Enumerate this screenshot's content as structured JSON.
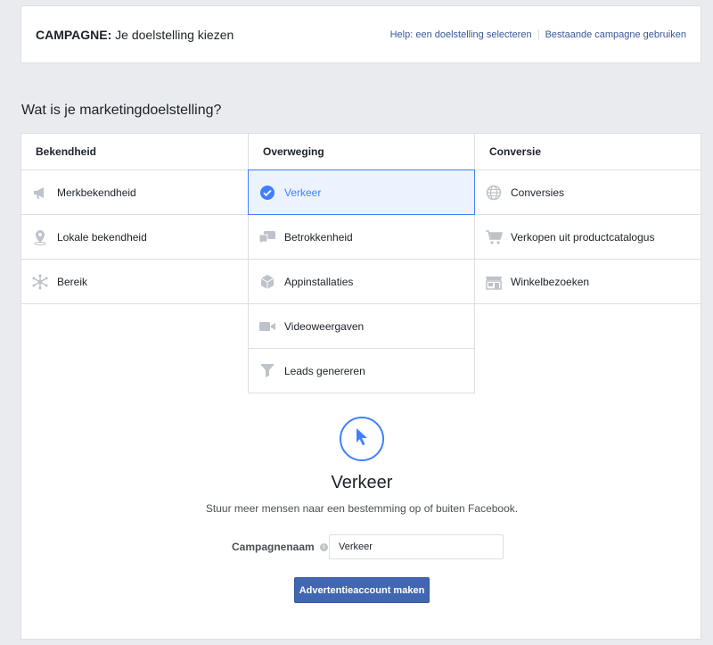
{
  "header": {
    "title_strong": "CAMPAGNE:",
    "title_rest": " Je doelstelling kiezen",
    "help_link": "Help: een doelstelling selecteren",
    "existing_link": "Bestaande campagne gebruiken"
  },
  "question": "Wat is je marketingdoelstelling?",
  "columns": [
    {
      "heading": "Bekendheid",
      "options": [
        {
          "label": "Merkbekendheid",
          "icon": "megaphone-icon"
        },
        {
          "label": "Lokale bekendheid",
          "icon": "map-pin-icon"
        },
        {
          "label": "Bereik",
          "icon": "reach-icon"
        }
      ]
    },
    {
      "heading": "Overweging",
      "options": [
        {
          "label": "Verkeer",
          "icon": "check-circle-icon",
          "selected": true
        },
        {
          "label": "Betrokkenheid",
          "icon": "chat-bubbles-icon"
        },
        {
          "label": "Appinstallaties",
          "icon": "box-icon"
        },
        {
          "label": "Videoweergaven",
          "icon": "video-camera-icon"
        },
        {
          "label": "Leads genereren",
          "icon": "funnel-icon"
        }
      ]
    },
    {
      "heading": "Conversie",
      "options": [
        {
          "label": "Conversies",
          "icon": "globe-icon"
        },
        {
          "label": "Verkopen uit productcatalogus",
          "icon": "shopping-cart-icon"
        },
        {
          "label": "Winkelbezoeken",
          "icon": "store-icon"
        }
      ]
    }
  ],
  "detail": {
    "icon": "cursor-icon",
    "title": "Verkeer",
    "description": "Stuur meer mensen naar een bestemming op of buiten Facebook."
  },
  "campaign_name": {
    "label": "Campagnenaam",
    "value": "Verkeer"
  },
  "create_button": "Advertentieaccount maken",
  "colors": {
    "accent": "#4080ff",
    "button": "#4267b2",
    "link": "#365899",
    "icon_gray": "#bec2c9"
  }
}
